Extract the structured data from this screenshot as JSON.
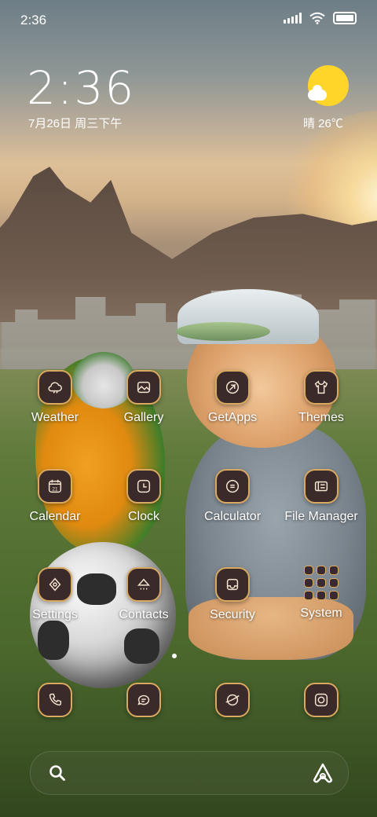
{
  "status_bar": {
    "time": "2:36",
    "icons": [
      "signal-icon",
      "wifi-icon",
      "battery-icon"
    ]
  },
  "clock_widget": {
    "time": "2:36",
    "date": "7月26日 周三下午"
  },
  "weather_widget": {
    "icon": "sun-cloud-icon",
    "text": "晴 26℃"
  },
  "apps": [
    {
      "label": "Weather",
      "icon": "cloud-icon"
    },
    {
      "label": "Gallery",
      "icon": "image-icon"
    },
    {
      "label": "GetApps",
      "icon": "getapps-icon"
    },
    {
      "label": "Themes",
      "icon": "tshirt-icon"
    },
    {
      "label": "Calendar",
      "icon": "calendar-icon"
    },
    {
      "label": "Clock",
      "icon": "clock-icon"
    },
    {
      "label": "Calculator",
      "icon": "calculator-icon"
    },
    {
      "label": "File Manager",
      "icon": "file-manager-icon"
    },
    {
      "label": "Settings",
      "icon": "settings-icon"
    },
    {
      "label": "Contacts",
      "icon": "contacts-icon"
    },
    {
      "label": "Security",
      "icon": "security-icon"
    },
    {
      "label": "System",
      "icon": "folder-icon"
    }
  ],
  "calendar_day": "21",
  "dock": [
    {
      "icon": "phone-icon"
    },
    {
      "icon": "messages-icon"
    },
    {
      "icon": "browser-icon"
    },
    {
      "icon": "camera-icon"
    }
  ],
  "search": {
    "left_icon": "search-icon",
    "right_icon": "assistant-icon"
  },
  "colors": {
    "icon_bg": "#3a2a2a",
    "icon_border": "#d9a861",
    "sun": "#ffd52a"
  }
}
